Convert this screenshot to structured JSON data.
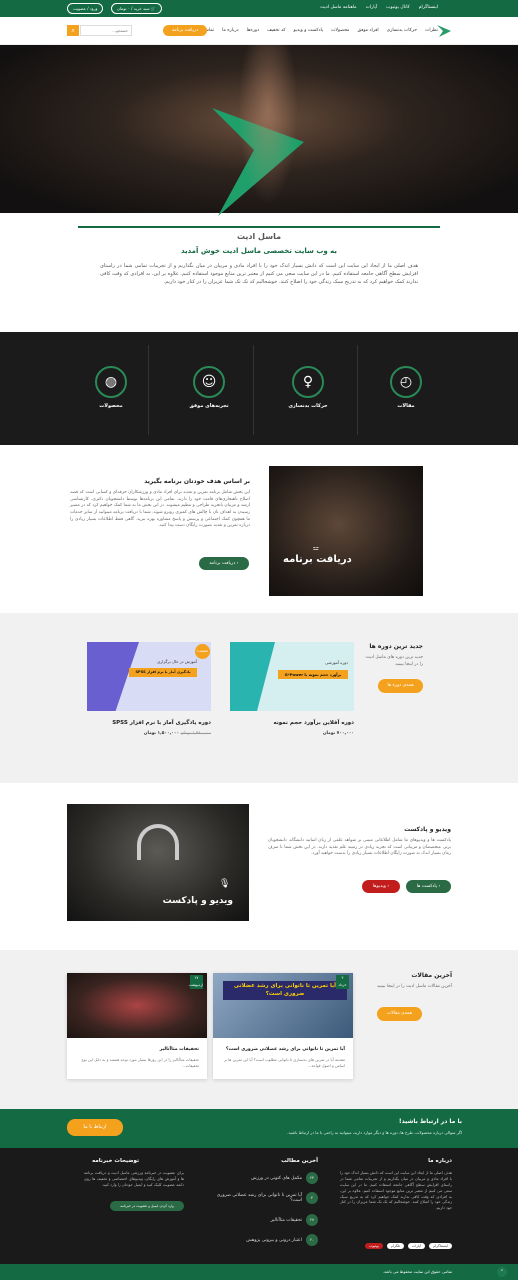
{
  "topbar": {
    "links": [
      "اینستاگرام",
      "کانال یوتیوب",
      "آپارات",
      "ماهنامه ماسل ادیت"
    ],
    "cart": "سبد خرید / ۰ تومان",
    "login": "ورود / عضویت"
  },
  "nav": {
    "items": [
      "نظرات",
      "حرکات بدنسازی",
      "افراد موفق",
      "محصولات",
      "پادکست و ویدیو",
      "کد تخفیف",
      "دوره‌ها",
      "درباره ما",
      "تماس با ما"
    ],
    "program_button": "دریافت برنامه",
    "search_placeholder": "جستجو..."
  },
  "intro": {
    "title": "ماسل ادیت",
    "subtitle": "به وب سایت تخصصی ماسل ادیت خوش آمدید",
    "body": "هدف اصلی ما از ایجاد این سایت این است که دانش بسیار اندک خود را با افراد مادی و مربیان در میان بگذاریم و از تجربیات تمامی شما در راستای افزایش سطح آگاهی جامعه استفاده کنیم. ما در این سایت سعی می کنیم از معتبر ترین منابع موجود استفاده کنیم. علاوه بر این، به افرادی که وقت کافی ندارند کمک خواهیم کرد که به تدریج سبک زندگی خود را اصلاح کنند. خوشحالیم که تک تک شما عزیزان را در کنار خود داریم."
  },
  "features": [
    {
      "label": "مقالات",
      "icon": "article-clock-icon"
    },
    {
      "label": "حرکات بدنسازی",
      "icon": "body-exercise-icon"
    },
    {
      "label": "تجربه‌های موفق",
      "icon": "success-person-icon"
    },
    {
      "label": "محصولات",
      "icon": "product-ball-icon"
    }
  ],
  "program": {
    "title": "بر اساس هدف خودتان برنامه بگیرید",
    "body": "این بخش شامل برنامه تمرین و تغذیه برای افراد مادی و ورزشکاران حرفه‌ای و کسانی است که قصد اصلاح ناهنجاری‌های قامت خود را دارند. تمامی این برنامه‌ها توسط دانشجویان دکتری، کارشناسی ارشد و مربیان باتجربه طراحی و تنظیم میشوند. در این بخش ما به شما کمک خواهیم کرد که در مسیر رسیدن به اهداف تان با چالش های کمتری روبرو شوید. شما با دریافت برنامه میتوانید از سایر خدمات ما همچون کمک اجتماعی و پرسش و پاسخ مشاوره بهره ببرید. گاهی فقط اطلاعات بسیار زیادی را درباره تمرین و تغذیه بصورت رایگان دست پیدا کنید.",
    "button": "دریافت برنامه",
    "image_caption": "دریافت برنامه"
  },
  "courses": {
    "title": "جدید ترین دوره ها",
    "desc": "جدید ترین دوره های ماسل ادیت را در اینجا ببینید",
    "button": "همه‌ی دوره ها",
    "items": [
      {
        "name": "دوره آفلاین برآورد حجم نمونه",
        "old_price": "",
        "price": "۷۰۰,۰۰۰ تومان",
        "banner_top": "دوره آموزشی",
        "banner_main": "برآورد حجم نمونه با G*Power"
      },
      {
        "name": "دوره یادگیری آمار با نرم افزار SPSS",
        "old_price": "۱,۹۸۰,۰۰۰ تومان",
        "price": "۱,۵۰۰,۰۰۰ تومان",
        "banner_top": "آموزش در حال برگزاری",
        "banner_main": "یادگیری آمار با نرم افزار SPSS",
        "badge": "تخفیف!"
      }
    ]
  },
  "podcast": {
    "title": "ویدیو و پادکست",
    "body": "پادکست ها و ویدیوهای ما شامل اطلاعاتی مبتنی بر شواهد علمی از زبان اساتید دانشگاه، دانشجویان برتر، متخصصان و مربیانی است که تجربه زیادی در زمینه علم تغذیه دارند. در این بخش شما با صرف زمان بسیار اندک به صورت رایگان اطلاعات بسیار زیادی را بدست خواهید آورد.",
    "button_podcast": "پادکست ها",
    "button_video": "ویدیوها",
    "image_caption": "ویدیو و پادکست"
  },
  "articles": {
    "title": "آخرین مقالات",
    "desc": "آخرین مقالات ماسل ادیت را در اینجا ببینید",
    "button": "همه‌ی مقالات",
    "items": [
      {
        "day": "۳",
        "month": "خرداد",
        "banner": "آیا تمرین تا ناتوانی برای رشد عضلانی ضروری است؟",
        "title": "آیا تمرین تا ناتوانی برای رشد عضلانی ضروری است؟",
        "excerpt": "مقدمه آیا در تمرین های بدنسازی تا ناتوانی مطلوب است؟ آیا این تمرین ها بر اساس و اصول قواعد..."
      },
      {
        "day": "۲۷",
        "month": "اردیبهشت",
        "title": "تحقیقات متاآنالیز",
        "excerpt": "تحقیقات متاآنالیز را در این روزها بسیار مورد توجه هستند و به دلیل این نوع تحقیقات..."
      }
    ]
  },
  "contact": {
    "title": "با ما در ارتباط باشید!",
    "desc": "اگر سوالی درباره محصولات، طرح ها، دوره ها و دیگر موارد دارید، میتوانید به راحتی با ما در ارتباط باشید.",
    "button": "ارتباط با ما"
  },
  "footer": {
    "about_title": "درباره ما",
    "about_text": "هدف اصلی ما از ایجاد این سایت این است که دانش بسیار اندک خود را با افراد مادی و مربیان در میان بگذاریم و از تجربیات تمامی شما در راستای افزایش سطح آگاهی جامعه استفاده کنیم. ما در این سایت سعی می کنیم از معتبر ترین منابع موجود استفاده کنیم. علاوه بر این، به افرادی که وقت کافی ندارند کمک خواهیم کرد که به تدریج سبک زندگی خود را اصلاح کنند. خوشحالیم که تک تک شما عزیزان را در کنار خود داریم.",
    "social": [
      "اینستاگرام",
      "آپارات",
      "تلگرام",
      "یوتیوب"
    ],
    "latest_title": "آخرین مطالب",
    "latest_items": [
      {
        "day": "۲۳",
        "title": "مکمل های کتونی در ورزش"
      },
      {
        "day": "۳",
        "title": "آیا تمرین تا ناتوانی برای رشد عضلانی ضروری است؟"
      },
      {
        "day": "۲۷",
        "title": "تحقیقات متاآنالیز"
      },
      {
        "day": "۲۰",
        "title": "اعتبار درونی و بیرونی پژوهش"
      }
    ],
    "program_title": "توضیحات خبرنامه",
    "program_text": "برای عضویت در خبرنامه ورزشی ماسل ادیت و دریافت برنامه ها و آموزش های رایگان، ویدیوهای اختصاصی و تخفیف ها روی دکمه عضویت کلیک کنید و ایمیل خودتان را وارد کنید.",
    "program_button": "وارد کردن ایمیل و عضویت در خبرنامه",
    "copyright": "تمامی حقوق این سایت محفوظ می باشد."
  },
  "colors": {
    "green": "#136a43",
    "orange": "#f4a21e",
    "red": "#c21d1d",
    "dark": "#1b1b1b"
  }
}
